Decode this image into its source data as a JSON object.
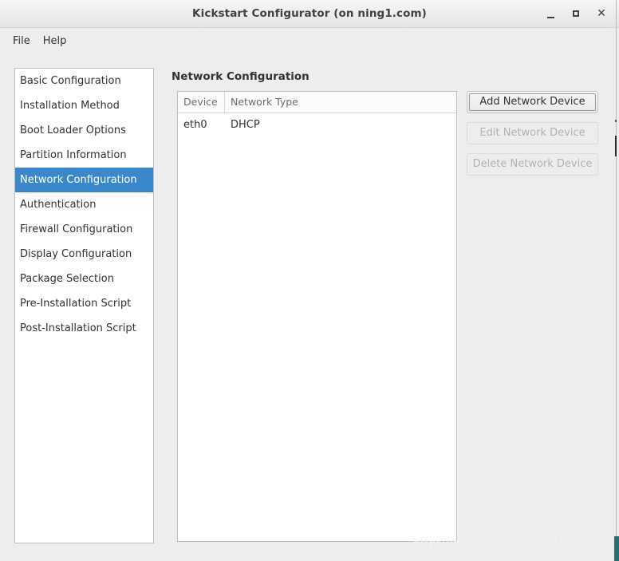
{
  "window": {
    "title": "Kickstart Configurator (on ning1.com)",
    "controls": {
      "minimize_label": "–",
      "maximize_label": "□",
      "close_label": "✕"
    },
    "accent_color": "#3a87ca",
    "background_color": "#ededed"
  },
  "menubar": {
    "items": [
      {
        "label": "File"
      },
      {
        "label": "Help"
      }
    ]
  },
  "sidebar": {
    "items": [
      {
        "label": "Basic Configuration",
        "selected": false
      },
      {
        "label": "Installation Method",
        "selected": false
      },
      {
        "label": "Boot Loader Options",
        "selected": false
      },
      {
        "label": "Partition Information",
        "selected": false
      },
      {
        "label": "Network Configuration",
        "selected": true
      },
      {
        "label": "Authentication",
        "selected": false
      },
      {
        "label": "Firewall Configuration",
        "selected": false
      },
      {
        "label": "Display Configuration",
        "selected": false
      },
      {
        "label": "Package Selection",
        "selected": false
      },
      {
        "label": "Pre-Installation Script",
        "selected": false
      },
      {
        "label": "Post-Installation Script",
        "selected": false
      }
    ]
  },
  "main": {
    "title": "Network Configuration",
    "table": {
      "columns": [
        "Device",
        "Network Type"
      ],
      "rows": [
        {
          "device": "eth0",
          "network_type": "DHCP"
        }
      ]
    },
    "buttons": [
      {
        "label": "Add Network Device",
        "enabled": true,
        "focused": true
      },
      {
        "label": "Edit Network Device",
        "enabled": false,
        "focused": false
      },
      {
        "label": "Delete Network Device",
        "enabled": false,
        "focused": false
      }
    ]
  },
  "watermark": {
    "text": "https://blog.csdn.net/qq_45652989"
  }
}
